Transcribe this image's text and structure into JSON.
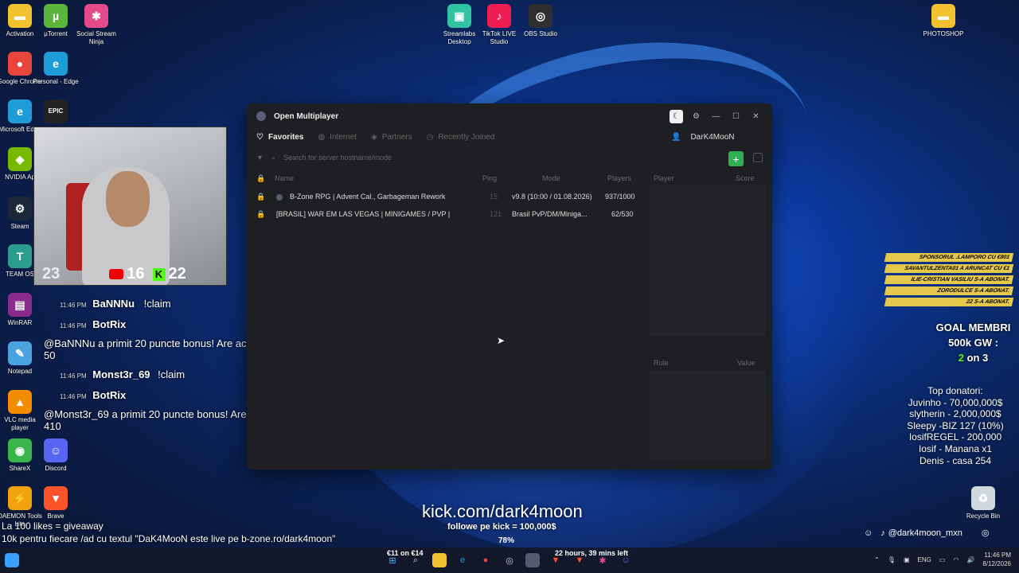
{
  "desktop_icons": [
    {
      "label": "Activation",
      "color": "#f2c230",
      "glyph": "▬"
    },
    {
      "label": "µTorrent",
      "color": "#5cb53a",
      "glyph": "µ"
    },
    {
      "label": "Social Stream Ninja",
      "color": "#e24a8a",
      "glyph": "✱"
    },
    {
      "label": "Google Chrome",
      "color": "#e8453c",
      "glyph": "●"
    },
    {
      "label": "Personal - Edge",
      "color": "#1f9cd8",
      "glyph": "e"
    },
    {
      "label": "Microsoft Edge",
      "color": "#1f9cd8",
      "glyph": "e"
    },
    {
      "label": "Epic Games",
      "color": "#222222",
      "glyph": "EPIC"
    },
    {
      "label": "NVIDIA Ap",
      "color": "#76b900",
      "glyph": "◈"
    },
    {
      "label": "Steam",
      "color": "#1b2838",
      "glyph": "⚙"
    },
    {
      "label": "TEAM OS",
      "color": "#2a9d8f",
      "glyph": "T"
    },
    {
      "label": "WinRAR",
      "color": "#8b2c8c",
      "glyph": "▤"
    },
    {
      "label": "Notepad",
      "color": "#4aa3df",
      "glyph": "✎"
    },
    {
      "label": "VLC media player",
      "color": "#f28c00",
      "glyph": "▲"
    },
    {
      "label": "ShareX",
      "color": "#39b54a",
      "glyph": "◉"
    },
    {
      "label": "Discord",
      "color": "#5865f2",
      "glyph": "☺"
    },
    {
      "label": "DAEMON Tools Lite",
      "color": "#f2a20c",
      "glyph": "⚡"
    },
    {
      "label": "Brave",
      "color": "#fb542b",
      "glyph": "▼"
    },
    {
      "label": "Streamlabs Desktop",
      "color": "#31c3a2",
      "glyph": "▣"
    },
    {
      "label": "TikTok LIVE Studio",
      "color": "#ee1d52",
      "glyph": "♪"
    },
    {
      "label": "OBS Studio",
      "color": "#302e31",
      "glyph": "◎"
    },
    {
      "label": "PHOTOSHOP",
      "color": "#f2c230",
      "glyph": "▬"
    },
    {
      "label": "Recycle Bin",
      "color": "#cfd8dc",
      "glyph": "♻"
    }
  ],
  "window": {
    "title": "Open Multiplayer",
    "tabs": [
      "Favorites",
      "Internet",
      "Partners",
      "Recently Joined"
    ],
    "username": "DarK4MooN",
    "search_placeholder": "Search for server hostname/mode",
    "add_label": "+",
    "columns": {
      "name": "Name",
      "ping": "Ping",
      "mode": "Mode",
      "players": "Players",
      "player": "Player",
      "score": "Score",
      "rule": "Rule",
      "value": "Value"
    },
    "servers": [
      {
        "name": "B-Zone RPG | Advent Cal., Garbageman Rework",
        "ping": "15",
        "mode": "v9.8 (10:00 / 01.08.2026)",
        "players": "937/1000"
      },
      {
        "name": "[BRASIL] WAR EM LAS VEGAS | MINIGAMES / PVP |",
        "ping": "121",
        "mode": "Brasil PvP/DM/Miniga...",
        "players": "62/530"
      }
    ]
  },
  "webcam": {
    "left_count": "23",
    "youtube_count": "16",
    "kick_count": "22"
  },
  "chat": [
    {
      "time": "11:46 PM",
      "user": "BaNNNu",
      "text": "!claim"
    },
    {
      "time": "11:46 PM",
      "user": "BotRix",
      "text": ""
    },
    {
      "time": "",
      "user": "",
      "text": "@BaNNNu a primit 20 puncte bonus! Are acum 50"
    },
    {
      "time": "11:46 PM",
      "user": "Monst3r_69",
      "text": "!claim"
    },
    {
      "time": "11:46 PM",
      "user": "BotRix",
      "text": ""
    },
    {
      "time": "",
      "user": "",
      "text": "@Monst3r_69 a primit 20 puncte bonus! Are acum 410"
    }
  ],
  "sponsors": [
    "SPONSORUL .LAMPORO CU €801",
    "SAVANTULZENTA01 A ARUNCAT CU €1",
    "ILIE-CRISTIAN VASILIU S-A ABONAT.",
    "ZORODULCE S-A ABONAT.",
    "22 S-A ABONAT."
  ],
  "goal": {
    "line1": "GOAL MEMBRI",
    "line2": "500k GW :",
    "count": "2",
    "suffix": "on 3"
  },
  "donors": {
    "title": "Top donatori:",
    "list": [
      "Juvinho - 70,000,000$",
      "slytherin - 2,000,000$",
      "Sleepy -BIZ 127 (10%)",
      "IosifREGEL - 200,000",
      "Iosif - Manana x1",
      "Denis - casa 254"
    ]
  },
  "overlay": {
    "likes": "La 100 likes = giveaway",
    "points": "10k pentru fiecare /ad cu textul \"DaK4MooN este live pe b-zone.ro/dark4moon\"",
    "kick_url": "kick.com/dark4moon",
    "kick_follow": "followe pe kick = 100,000$",
    "percent": "78%",
    "social_handle": "@dark4moon_mxn",
    "taskbar_left": "€11 on €14",
    "taskbar_mid": "22 hours, 39 mins left"
  },
  "taskbar": {
    "lang": "ENG",
    "time": "11:46 PM",
    "date": "8/12/2026"
  }
}
